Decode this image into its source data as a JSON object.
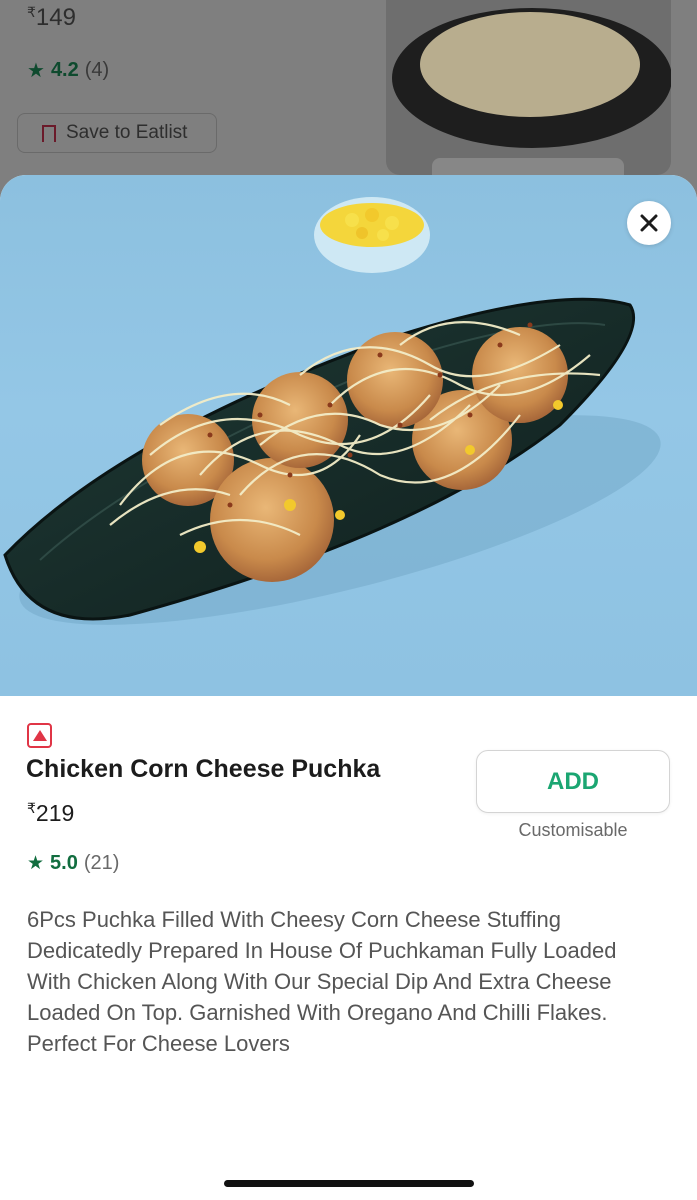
{
  "background_item": {
    "price_currency": "₹",
    "price": "149",
    "rating": "4.2",
    "rating_count": "(4)",
    "save_label": "Save to Eatlist"
  },
  "item": {
    "veg_type": "non-veg",
    "name": "Chicken Corn Cheese Puchka",
    "price_currency": "₹",
    "price": "219",
    "rating": "5.0",
    "rating_count": "(21)",
    "add_label": "ADD",
    "customisable_label": "Customisable",
    "description": "6Pcs Puchka Filled With Cheesy Corn Cheese Stuffing Dedicatedly Prepared In House Of Puchkaman Fully Loaded With Chicken Along With Our Special Dip And Extra Cheese Loaded On Top. Garnished With Oregano And Chilli Flakes. Perfect For Cheese Lovers"
  },
  "colors": {
    "accent_green": "#1ba672",
    "rating_green": "#116d3f",
    "nonveg_red": "#e03546",
    "hero_bg": "#8ec2e2"
  },
  "icons": {
    "close": "close-icon",
    "star": "star-icon",
    "bookmark": "bookmark-icon",
    "nonveg": "non-veg-indicator-icon"
  }
}
